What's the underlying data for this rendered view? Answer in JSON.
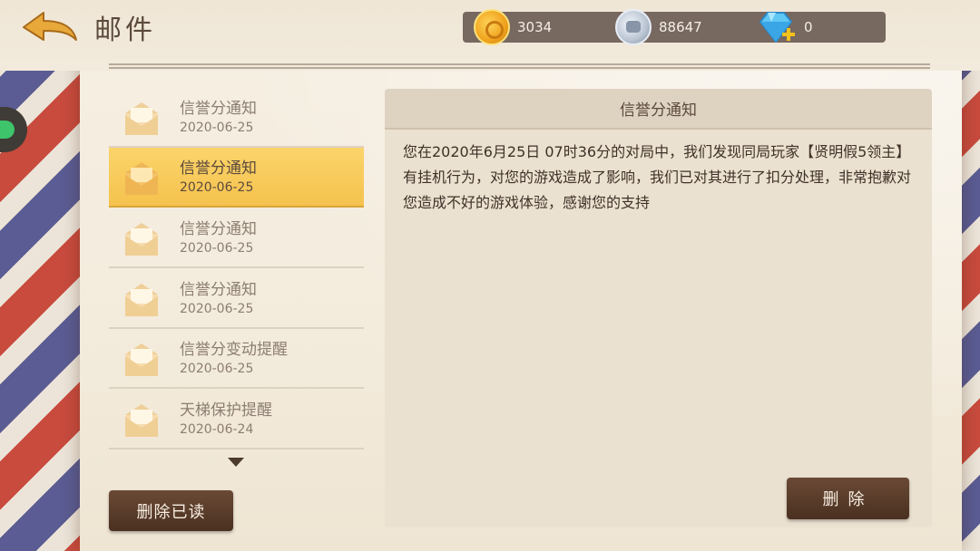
{
  "header": {
    "title": "邮件",
    "back_icon": "back-arrow-icon"
  },
  "currencies": [
    {
      "icon": "gold-coin-icon",
      "value": "3034"
    },
    {
      "icon": "silver-coin-icon",
      "value": "88647"
    },
    {
      "icon": "diamond-add-icon",
      "value": "0"
    }
  ],
  "mail_list": [
    {
      "title": "信誉分通知",
      "date": "2020-06-25",
      "selected": false
    },
    {
      "title": "信誉分通知",
      "date": "2020-06-25",
      "selected": true
    },
    {
      "title": "信誉分通知",
      "date": "2020-06-25",
      "selected": false
    },
    {
      "title": "信誉分通知",
      "date": "2020-06-25",
      "selected": false
    },
    {
      "title": "信誉分变动提醒",
      "date": "2020-06-25",
      "selected": false
    },
    {
      "title": "天梯保护提醒",
      "date": "2020-06-24",
      "selected": false
    }
  ],
  "buttons": {
    "delete_read": "删除已读",
    "delete": "删除"
  },
  "detail": {
    "title": "信誉分通知",
    "body": "您在2020年6月25日  07时36分的对局中，我们发现同局玩家【贤明假5领主】有挂机行为，对您的游戏造成了影响，我们已对其进行了扣分处理，非常抱歉对您造成不好的游戏体验，感谢您的支持"
  },
  "colors": {
    "selected_item": "#f5c24e",
    "button_bg": "#4a3020",
    "panel_bg": "#ebe1d0"
  }
}
